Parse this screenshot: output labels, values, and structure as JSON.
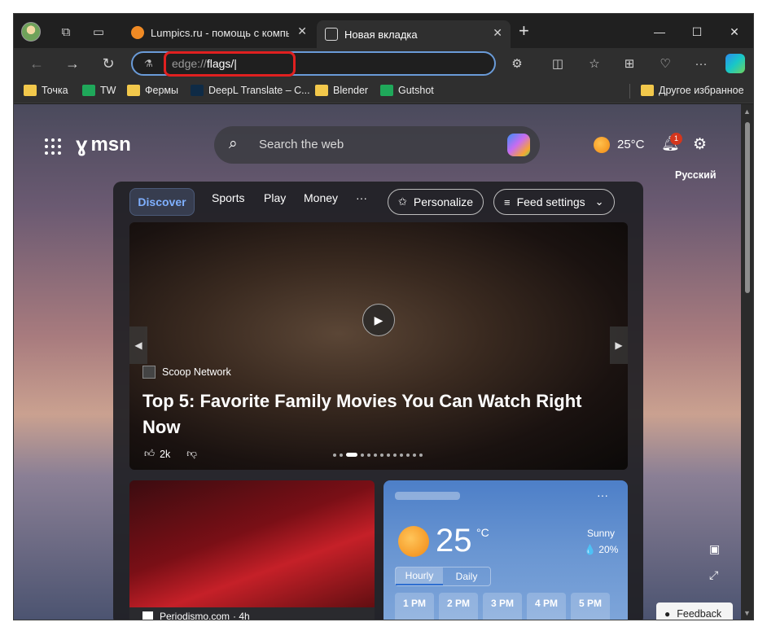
{
  "browser": {
    "tabs": [
      {
        "label": "Lumpics.ru - помощь с компьют",
        "active": false
      },
      {
        "label": "Новая вкладка",
        "active": true
      }
    ],
    "tab_close": "✕",
    "new_tab": "+",
    "window_controls": {
      "minimize": "—",
      "maximize": "☐",
      "close": "✕"
    },
    "address": {
      "protocol": "edge://",
      "path": "flags/",
      "cursor": "|"
    },
    "bookmarks": [
      {
        "label": "Точка",
        "icon": "folder-icon"
      },
      {
        "label": "TW",
        "icon": "green-plus-icon"
      },
      {
        "label": "Фермы",
        "icon": "folder-icon"
      },
      {
        "label": "DeepL Translate – C...",
        "icon": "deepl-icon"
      },
      {
        "label": "Blender",
        "icon": "folder-icon"
      },
      {
        "label": "Gutshot",
        "icon": "green-plus-icon"
      }
    ],
    "other_favorites": "Другое избранное",
    "highlight_color": "#e02020",
    "accent": "#6a9bd8"
  },
  "msn": {
    "logo": "msn",
    "search_placeholder": "Search the web",
    "weather_temp": "25°C",
    "notifications_count": "1",
    "language": "Русский",
    "tabs": [
      "Discover",
      "Sports",
      "Play",
      "Money",
      "···"
    ],
    "personalize": "Personalize",
    "feed_settings": "Feed settings",
    "hero": {
      "source": "Scoop Network",
      "headline": "Top 5: Favorite Family Movies You Can Watch Right Now",
      "likes": "2k"
    },
    "article": {
      "source": "Periodismo.com",
      "age": "· 4h"
    },
    "weather_card": {
      "more": "···",
      "temp": "25",
      "unit": "°C",
      "condition": "Sunny",
      "precip": "💧 20%",
      "tabs": [
        "Hourly",
        "Daily"
      ],
      "hours": [
        "1 PM",
        "2 PM",
        "3 PM",
        "4 PM",
        "5 PM"
      ]
    },
    "feedback": "Feedback"
  }
}
